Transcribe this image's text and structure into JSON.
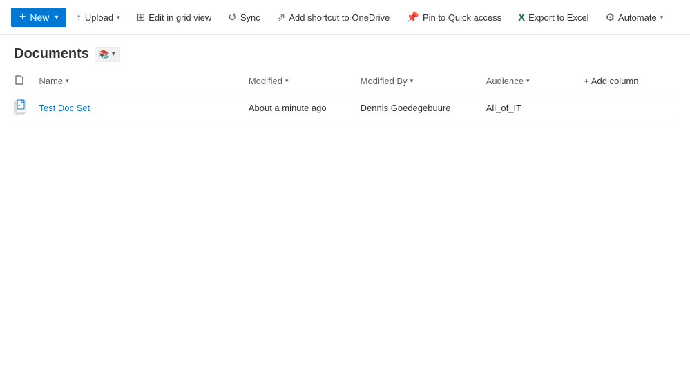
{
  "toolbar": {
    "new_label": "New",
    "upload_label": "Upload",
    "edit_grid_label": "Edit in grid view",
    "sync_label": "Sync",
    "add_shortcut_label": "Add shortcut to OneDrive",
    "pin_quick_access_label": "Pin to Quick access",
    "export_excel_label": "Export to Excel",
    "automate_label": "Automate"
  },
  "page": {
    "title": "Documents",
    "view_icon": "📚"
  },
  "table": {
    "columns": {
      "name": "Name",
      "modified": "Modified",
      "modified_by": "Modified By",
      "audience": "Audience",
      "add_column": "+ Add column"
    },
    "rows": [
      {
        "name": "Test Doc Set",
        "modified": "About a minute ago",
        "modified_by": "Dennis Goedegebuure",
        "audience": "All_of_IT"
      }
    ]
  },
  "icons": {
    "plus": "+",
    "chevron_down": "▾",
    "chevron_up": "↑",
    "upload_icon": "↑",
    "grid_icon": "⊞",
    "sync_icon": "↺",
    "shortcut_icon": "⇗",
    "pin_icon": "📌",
    "excel_icon": "X",
    "automate_icon": "⚙"
  }
}
